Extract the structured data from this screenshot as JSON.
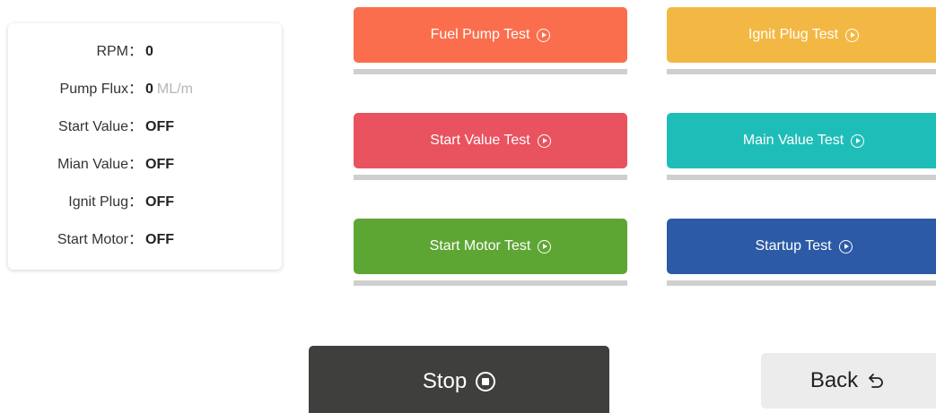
{
  "status": {
    "rows": [
      {
        "label": "RPM：",
        "value": "0",
        "unit": ""
      },
      {
        "label": "Pump Flux：",
        "value": "0",
        "unit": "ML/m"
      },
      {
        "label": "Start Value：",
        "value": "OFF",
        "unit": ""
      },
      {
        "label": "Mian Value：",
        "value": "OFF",
        "unit": ""
      },
      {
        "label": "Ignit Plug：",
        "value": "OFF",
        "unit": ""
      },
      {
        "label": "Start Motor：",
        "value": "OFF",
        "unit": ""
      }
    ]
  },
  "tests": [
    {
      "label": "Fuel Pump Test",
      "color": "#fb6e4d",
      "icon": "play-circle-icon"
    },
    {
      "label": "Ignit Plug Test",
      "color": "#f3b843",
      "icon": "play-circle-icon"
    },
    {
      "label": "Start Value Test",
      "color": "#e9525f",
      "icon": "play-circle-icon"
    },
    {
      "label": "Main Value Test",
      "color": "#1fbdb7",
      "icon": "play-circle-icon"
    },
    {
      "label": "Start Motor Test",
      "color": "#5ea634",
      "icon": "play-circle-icon"
    },
    {
      "label": "Startup Test",
      "color": "#2c5aa6",
      "icon": "play-circle-icon"
    }
  ],
  "actions": {
    "stop_label": "Stop",
    "stop_icon": "stop-circle-icon",
    "back_label": "Back",
    "back_icon": "undo-arrow-icon"
  }
}
